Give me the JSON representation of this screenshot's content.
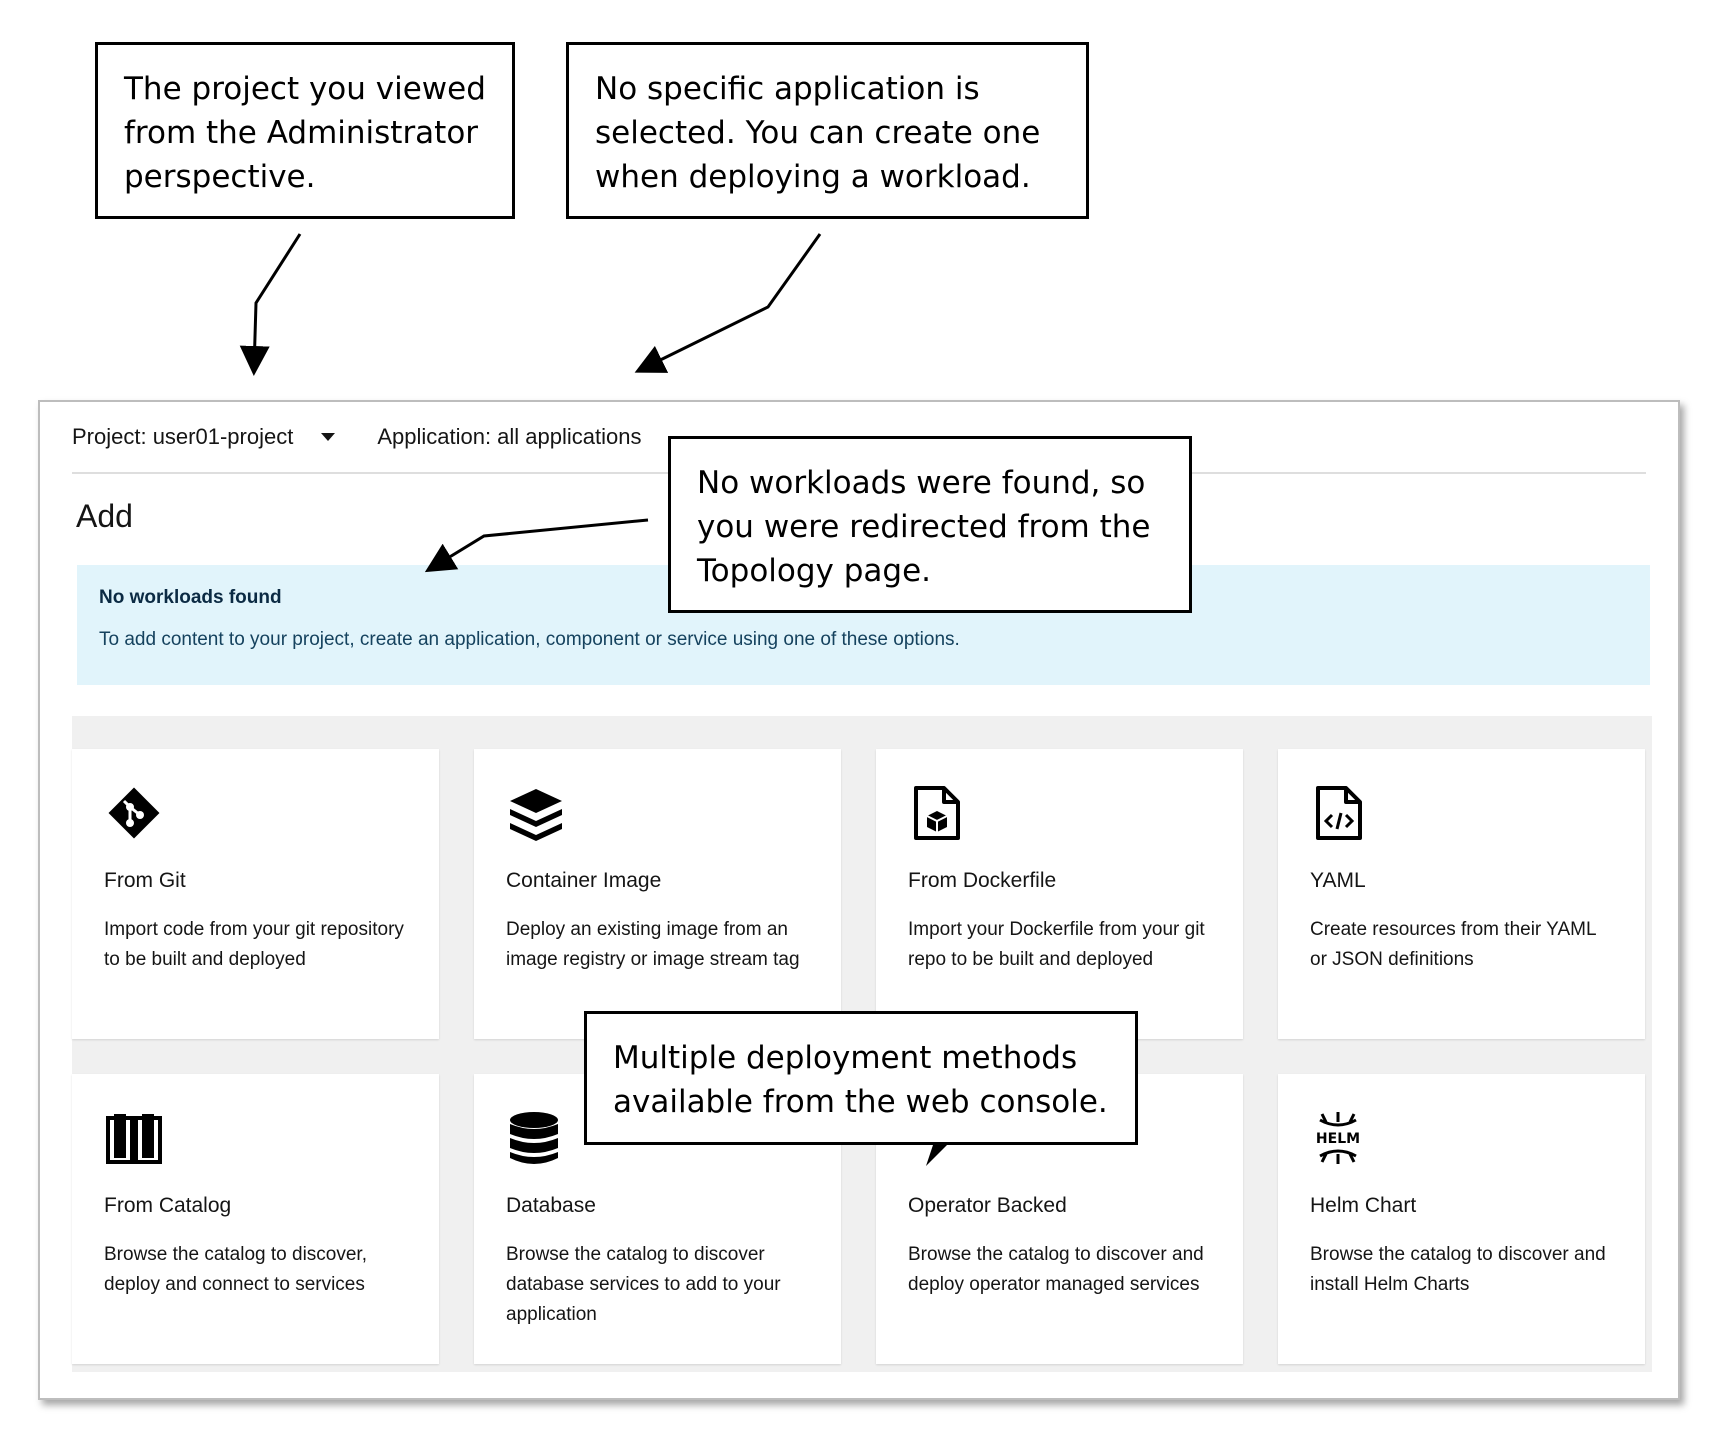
{
  "callouts": {
    "project": "The project you viewed from the Administrator perspective.",
    "application": "No specific application is selected. You can create one when deploying a workload.",
    "workloads": "No workloads were found, so you were redirected from the Topology page.",
    "methods": "Multiple deployment methods available from the web console."
  },
  "topbar": {
    "project_selector": "Project: user01-project",
    "application_selector": "Application: all applications"
  },
  "page_title": "Add",
  "alert": {
    "title": "No workloads found",
    "body": "To add content to your project, create an application, component or service using one of these options."
  },
  "cards": [
    {
      "icon": "git-icon",
      "title": "From Git",
      "description": "Import code from your git repository to be built and deployed"
    },
    {
      "icon": "layers-icon",
      "title": "Container Image",
      "description": "Deploy an existing image from an image registry or image stream tag"
    },
    {
      "icon": "dockerfile-icon",
      "title": "From Dockerfile",
      "description": "Import your Dockerfile from your git repo to be built and deployed"
    },
    {
      "icon": "yaml-file-icon",
      "title": "YAML",
      "description": "Create resources from their YAML or JSON definitions"
    },
    {
      "icon": "book-icon",
      "title": "From Catalog",
      "description": "Browse the catalog to discover, deploy and connect to services"
    },
    {
      "icon": "database-icon",
      "title": "Database",
      "description": "Browse the catalog to discover database services to add to your application"
    },
    {
      "icon": "bolt-icon",
      "title": "Operator Backed",
      "description": "Browse the catalog to discover and deploy operator managed services"
    },
    {
      "icon": "helm-icon",
      "title": "Helm Chart",
      "description": "Browse the catalog to discover and install Helm Charts",
      "icon_text": "HELM"
    }
  ]
}
